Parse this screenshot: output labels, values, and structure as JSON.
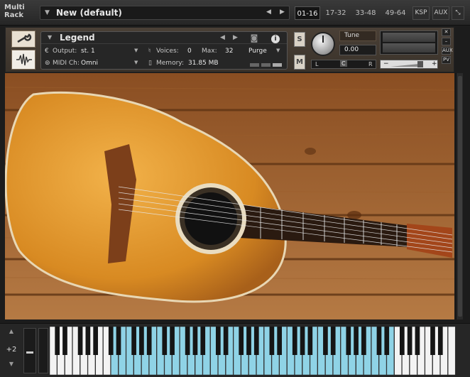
{
  "rack": {
    "label": "Multi Rack",
    "preset_name": "New (default)",
    "tabs": [
      "01-16",
      "17-32",
      "33-48",
      "49-64"
    ],
    "active_tab": 0,
    "ksp_label": "KSP",
    "aux_label": "AUX"
  },
  "instrument": {
    "name": "Legend",
    "output_label": "Output:",
    "output_value": "st. 1",
    "voices_label": "Voices:",
    "voices_value": "0",
    "max_label": "Max:",
    "max_value": "32",
    "purge_label": "Purge",
    "midi_label": "MIDI Ch:",
    "midi_value": "Omni",
    "memory_label": "Memory:",
    "memory_value": "31.85 MB",
    "solo_label": "S",
    "mute_label": "M",
    "tune_label": "Tune",
    "tune_value": "0.00",
    "pan_left": "L",
    "pan_center": "C",
    "pan_right": "R",
    "vol_minus": "−",
    "vol_plus": "+",
    "aux_label": "AUX",
    "pv_label": "PV"
  },
  "keyboard": {
    "octave_value": "+2"
  },
  "colors": {
    "accent_keys": "#8fd3e6",
    "wood": "#a4652f"
  }
}
